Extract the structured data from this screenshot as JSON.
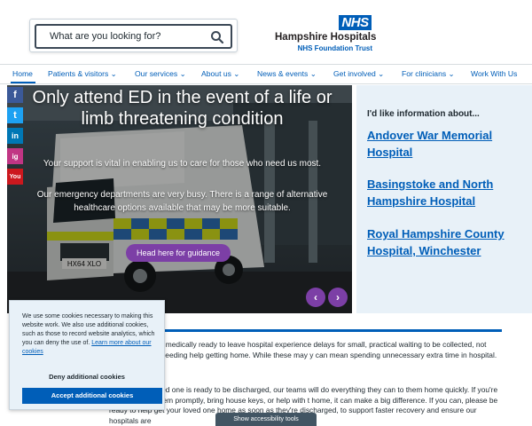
{
  "header": {
    "search_placeholder": "What are you looking for?",
    "nhs_logo": "NHS",
    "org_name": "Hampshire Hospitals",
    "org_sub": "NHS Foundation Trust"
  },
  "nav": {
    "items": [
      {
        "label": "Home"
      },
      {
        "label": "Patients & visitors ⌄"
      },
      {
        "label": "Our services ⌄"
      },
      {
        "label": "About us ⌄"
      },
      {
        "label": "News & events ⌄"
      },
      {
        "label": "Get involved ⌄"
      },
      {
        "label": "For clinicians ⌄"
      },
      {
        "label": "Work With Us"
      }
    ]
  },
  "social": {
    "facebook": "f",
    "twitter": "t",
    "linkedin": "in",
    "instagram": "ig",
    "youtube": "You"
  },
  "hero": {
    "title": "Only attend ED in the event of a life or limb threatening condition",
    "text1": "Your support is vital in enabling us to care for those who need us most.",
    "text2": "Our emergency departments are very busy. There is a range of alternative healthcare options available that may be more suitable.",
    "button": "Head here for guidance",
    "prev": "‹",
    "next": "›",
    "plate": "HX64 XLO"
  },
  "info_panel": {
    "heading": "I'd like information about...",
    "links": [
      {
        "label": "Andover War Memorial Hospital"
      },
      {
        "label": "Basingstoke and North Hampshire Hospital"
      },
      {
        "label": "Royal Hampshire County Hospital, Winchester"
      }
    ]
  },
  "content": {
    "p1": "patients who are medically ready to leave hospital experience delays for small, practical waiting to be collected, not having keys, or needing help getting home. While these may y can mean spending unnecessary extra time in hospital.",
    "p2": "d, relative or loved one is ready to be discharged, our teams will do everything they can to them home quickly. If you're able to collect them promptly, bring house keys, or help with t home, it can make a big difference. If you can, please be ready to help get your loved one home as soon as they're discharged, to support faster recovery and ensure our hospitals are"
  },
  "cookie": {
    "text": "We use some cookies necessary to making this website work. We also use additional cookies, such as those to record website analytics, which you can deny the use of.",
    "link": "Learn more about our cookies",
    "deny": "Deny additional cookies",
    "accept": "Accept additional cookies"
  },
  "accessibility": {
    "label": "Show accessibility tools"
  },
  "colors": {
    "nhs_blue": "#005eb8",
    "purple": "#7c3fa6",
    "panel": "#e8f1f8"
  }
}
